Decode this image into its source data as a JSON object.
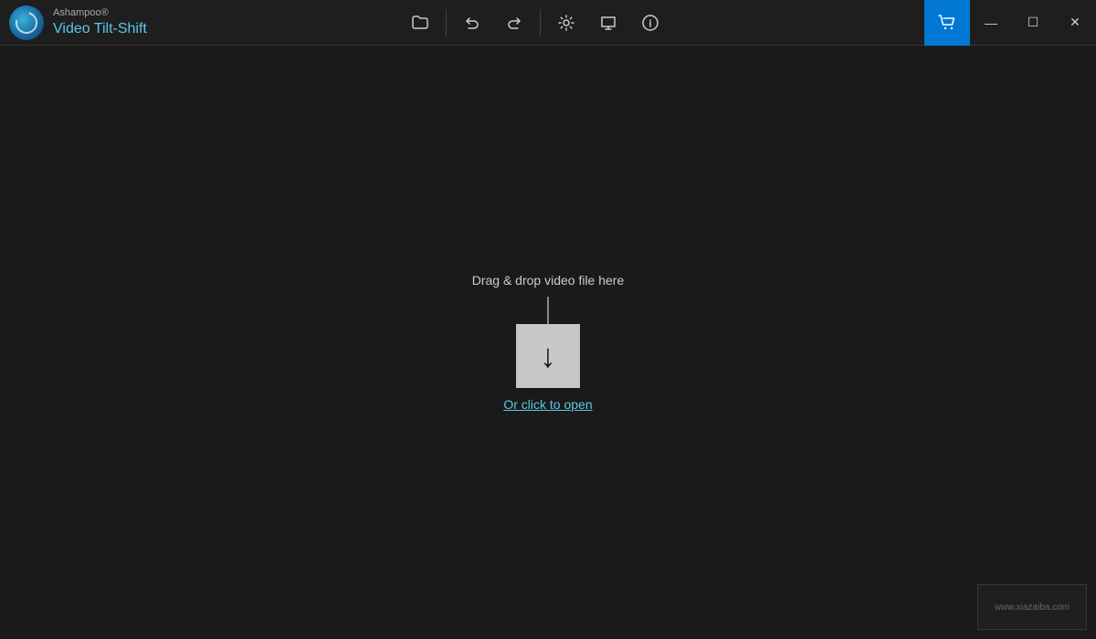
{
  "app": {
    "brand": "Ashampoo®",
    "name": "Video Tilt-Shift"
  },
  "toolbar": {
    "open_file_icon": "📁",
    "undo_icon": "↩",
    "redo_icon": "↪",
    "settings_icon": "⚙",
    "preview_icon": "⚑",
    "info_icon": "ℹ"
  },
  "window_controls": {
    "cart_icon": "🛒",
    "minimize_label": "—",
    "maximize_label": "☐",
    "close_label": "✕"
  },
  "main": {
    "drag_drop_label": "Drag & drop video file here",
    "click_to_open_label": "Or click to open"
  },
  "watermark": {
    "text": "www.xiazaiba.com"
  },
  "colors": {
    "accent": "#5bc8e8",
    "cart_btn": "#0078d4",
    "background": "#1a1a1a",
    "titlebar": "#1e1e1e"
  }
}
